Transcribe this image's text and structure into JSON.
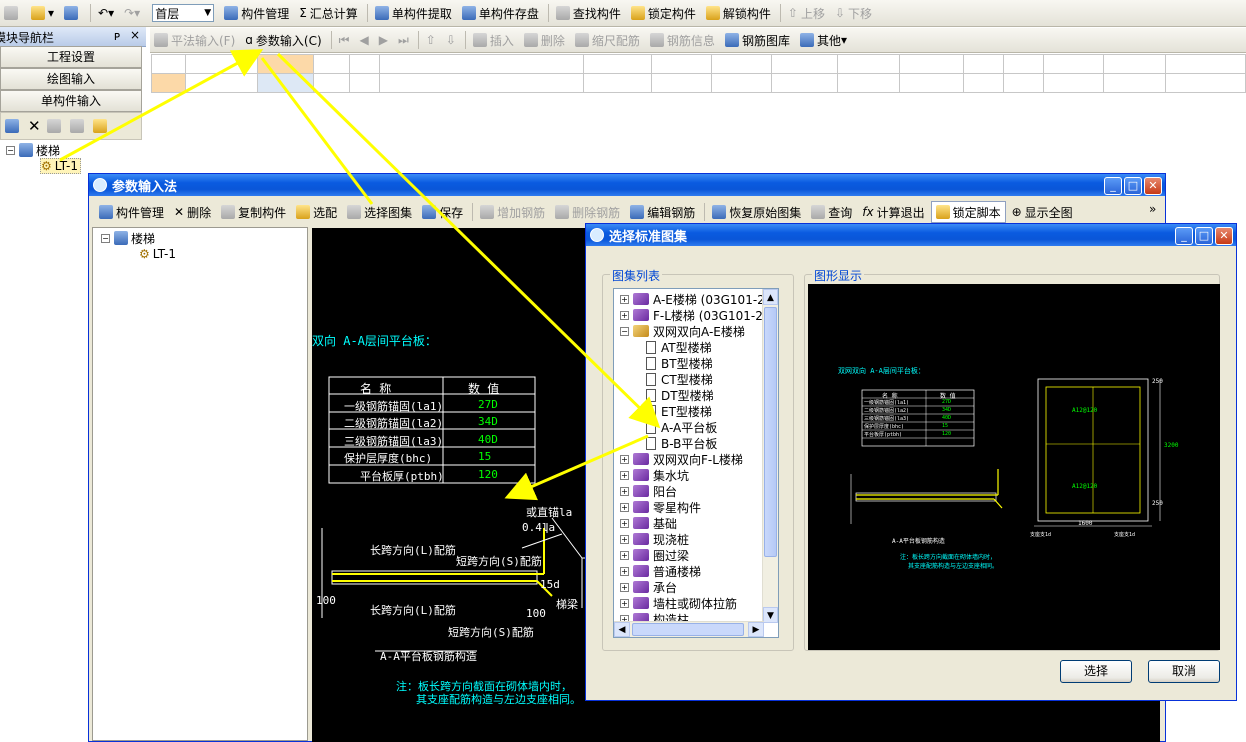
{
  "main_toolbar": {
    "floor": "首层",
    "component_manage": "构件管理",
    "sum_calc": "汇总计算",
    "single_extract": "单构件提取",
    "single_save": "单构件存盘",
    "find": "查找构件",
    "lock": "锁定构件",
    "unlock": "解锁构件",
    "move_up": "上移",
    "move_down": "下移"
  },
  "second_toolbar": {
    "flat_input": "平法输入(F)",
    "param_input": "参数输入(C)",
    "insert": "插入",
    "delete": "删除",
    "scale": "缩尺配筋",
    "rebar_info": "钢筋信息",
    "rebar_lib": "钢筋图库",
    "other": "其他"
  },
  "nav": {
    "title": "模块导航栏",
    "pin": "ᴘ",
    "close": "×",
    "buttons": [
      "工程设置",
      "绘图输入",
      "单构件输入"
    ],
    "tree_root": "楼梯",
    "tree_child": "LT-1"
  },
  "param_window": {
    "title": "参数输入法",
    "toolbar": [
      "构件管理",
      "删除",
      "复制构件",
      "选配",
      "选择图集",
      "保存",
      "增加钢筋",
      "删除钢筋",
      "编辑钢筋",
      "恢复原始图集",
      "查询",
      "计算退出",
      "锁定脚本",
      "显示全图"
    ],
    "tree_root": "楼梯",
    "tree_child": "LT-1",
    "cad": {
      "heading": "双向 A-A层间平台板：",
      "table_head": [
        "名 称",
        "数 值"
      ],
      "rows": [
        {
          "name": "一级钢筋锚固(la1)",
          "value": "27D"
        },
        {
          "name": "二级钢筋锚固(la2)",
          "value": "34D"
        },
        {
          "name": "三级钢筋锚固(la3)",
          "value": "40D"
        },
        {
          "name": "保护层厚度(bhc)",
          "value": "15"
        },
        {
          "name": "平台板厚(ptbh)",
          "value": "120"
        }
      ],
      "labels": {
        "straight_anchor": "或直锚la",
        "anchor_04": "0.4la",
        "long_top": "长跨方向(L)配筋",
        "short_top": "短跨方向(S)配筋",
        "hook": "15d",
        "dim100a": "100",
        "dim100b": "100",
        "beam": "梯梁",
        "long_bottom": "长跨方向(L)配筋",
        "short_bottom": "短跨方向(S)配筋",
        "caption": "A-A平台板钢筋构造",
        "note1": "注：板长跨方向截面在砌体墙内时，",
        "note2": "其支座配筋构造与左边支座相同。"
      }
    }
  },
  "select_dialog": {
    "title": "选择标准图集",
    "list_label": "图集列表",
    "preview_label": "图形显示",
    "tree": [
      {
        "label": "A-E楼梯 (03G101-2)",
        "kind": "book",
        "expanded": false,
        "level": 0
      },
      {
        "label": "F-L楼梯 (03G101-2)",
        "kind": "book",
        "expanded": false,
        "level": 0
      },
      {
        "label": "双网双向A-E楼梯",
        "kind": "book-open",
        "expanded": true,
        "level": 0
      },
      {
        "label": "AT型楼梯",
        "kind": "doc",
        "level": 1
      },
      {
        "label": "BT型楼梯",
        "kind": "doc",
        "level": 1
      },
      {
        "label": "CT型楼梯",
        "kind": "doc",
        "level": 1
      },
      {
        "label": "DT型楼梯",
        "kind": "doc",
        "level": 1
      },
      {
        "label": "ET型楼梯",
        "kind": "doc",
        "level": 1
      },
      {
        "label": "A-A平台板",
        "kind": "doc",
        "level": 1
      },
      {
        "label": "B-B平台板",
        "kind": "doc",
        "level": 1
      },
      {
        "label": "双网双向F-L楼梯",
        "kind": "book",
        "expanded": false,
        "level": 0
      },
      {
        "label": "集水坑",
        "kind": "book",
        "expanded": false,
        "level": 0
      },
      {
        "label": "阳台",
        "kind": "book",
        "expanded": false,
        "level": 0
      },
      {
        "label": "零星构件",
        "kind": "book",
        "expanded": false,
        "level": 0
      },
      {
        "label": "基础",
        "kind": "book",
        "expanded": false,
        "level": 0
      },
      {
        "label": "现浇桩",
        "kind": "book",
        "expanded": false,
        "level": 0
      },
      {
        "label": "圈过梁",
        "kind": "book",
        "expanded": false,
        "level": 0
      },
      {
        "label": "普通楼梯",
        "kind": "book",
        "expanded": false,
        "level": 0
      },
      {
        "label": "承台",
        "kind": "book",
        "expanded": false,
        "level": 0
      },
      {
        "label": "墙柱或砌体拉筋",
        "kind": "book",
        "expanded": false,
        "level": 0
      },
      {
        "label": "构造柱",
        "kind": "book",
        "expanded": false,
        "level": 0
      }
    ],
    "preview": {
      "heading": "双网双向 A-A层间平台板：",
      "table_head": [
        "名 称",
        "数 值"
      ],
      "rows": [
        {
          "name": "一级钢筋锚固(la1)",
          "value": "27D"
        },
        {
          "name": "二级钢筋锚固(la2)",
          "value": "34D"
        },
        {
          "name": "三级钢筋锚固(la3)",
          "value": "40D"
        },
        {
          "name": "保护层厚度(bhc)",
          "value": "15"
        },
        {
          "name": "平台板厚(ptbh)",
          "value": "120"
        }
      ],
      "dim_top": "250",
      "dim_mid": "3200",
      "dim_bottom": "250",
      "dim_span": "1600",
      "rebar_a": "A12@120",
      "rebar_b": "A12@120",
      "left_support": "支座支1d",
      "right_support": "支座支1d",
      "caption": "A-A平台板钢筋构造",
      "note1": "注：板长跨方向截面在砌体墙内时，",
      "note2": "其支座配筋构造与左边支座相同。"
    },
    "select_button": "选择",
    "cancel_button": "取消"
  },
  "colors": {
    "arrow": "#ffff00",
    "cad_text": "#ffffff",
    "cad_cyan": "#00ffff",
    "cad_green": "#00ff00",
    "cad_yellow": "#ffff00"
  }
}
